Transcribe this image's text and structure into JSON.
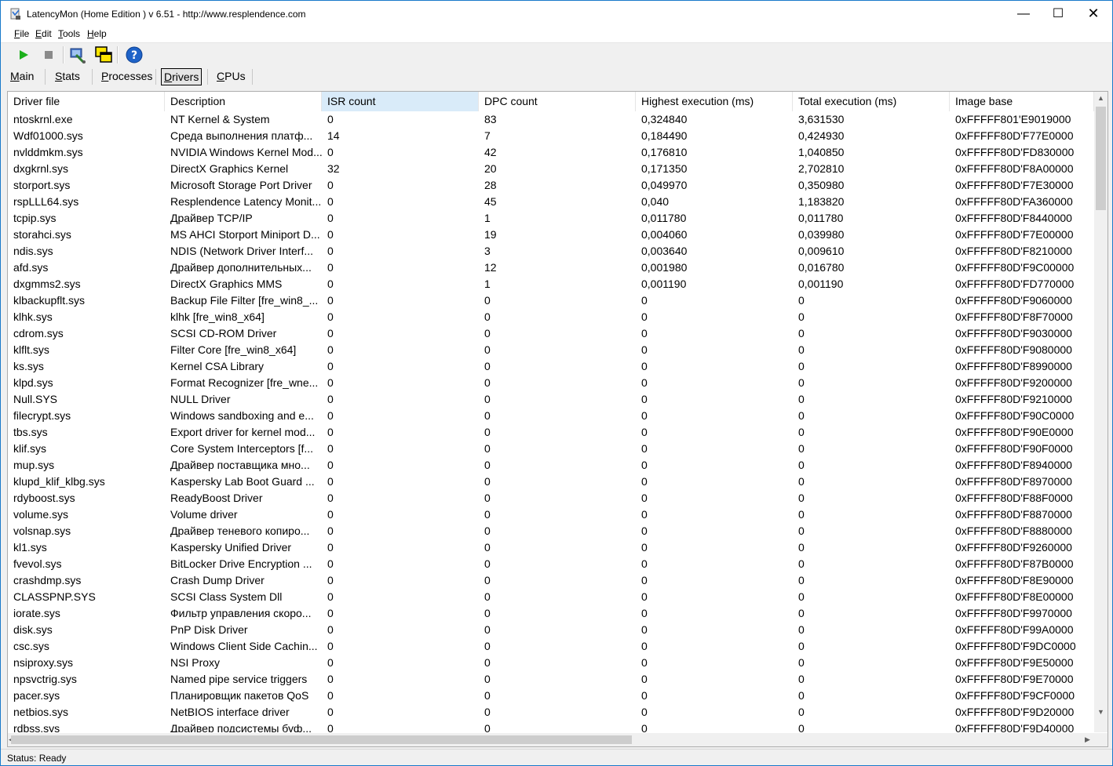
{
  "window": {
    "title": "LatencyMon  (Home Edition )  v 6.51 - http://www.resplendence.com",
    "minimize": "—",
    "maximize": "☐",
    "close": "✕"
  },
  "menu": [
    {
      "label": "File"
    },
    {
      "label": "Edit"
    },
    {
      "label": "Tools"
    },
    {
      "label": "Help"
    }
  ],
  "toolbar": {
    "icons": [
      "play-icon",
      "stop-icon",
      "tools-icon",
      "windows-icon",
      "help-icon"
    ],
    "colors": {
      "play": "#1cb01c",
      "stop": "#8a8a8a",
      "help": "#1e63c8"
    }
  },
  "tabs": [
    {
      "label": "Main"
    },
    {
      "label": "Stats"
    },
    {
      "label": "Processes"
    },
    {
      "label": "Drivers",
      "active": true
    },
    {
      "label": "CPUs"
    }
  ],
  "table": {
    "columns": [
      "Driver file",
      "Description",
      "ISR count",
      "DPC count",
      "Highest execution (ms)",
      "Total execution (ms)",
      "Image base"
    ],
    "sorted_column": "ISR count",
    "rows": [
      [
        "ntoskrnl.exe",
        "NT Kernel & System",
        "0",
        "83",
        "0,324840",
        "3,631530",
        "0xFFFFF801'E9019000"
      ],
      [
        "Wdf01000.sys",
        "Среда выполнения платф...",
        "14",
        "7",
        "0,184490",
        "0,424930",
        "0xFFFFF80D'F77E0000"
      ],
      [
        "nvlddmkm.sys",
        "NVIDIA Windows Kernel Mod...",
        "0",
        "42",
        "0,176810",
        "1,040850",
        "0xFFFFF80D'FD830000"
      ],
      [
        "dxgkrnl.sys",
        "DirectX Graphics Kernel",
        "32",
        "20",
        "0,171350",
        "2,702810",
        "0xFFFFF80D'F8A00000"
      ],
      [
        "storport.sys",
        "Microsoft Storage Port Driver",
        "0",
        "28",
        "0,049970",
        "0,350980",
        "0xFFFFF80D'F7E30000"
      ],
      [
        "rspLLL64.sys",
        "Resplendence Latency Monit...",
        "0",
        "45",
        "0,040",
        "1,183820",
        "0xFFFFF80D'FA360000"
      ],
      [
        "tcpip.sys",
        "Драйвер TCP/IP",
        "0",
        "1",
        "0,011780",
        "0,011780",
        "0xFFFFF80D'F8440000"
      ],
      [
        "storahci.sys",
        "MS AHCI Storport Miniport D...",
        "0",
        "19",
        "0,004060",
        "0,039980",
        "0xFFFFF80D'F7E00000"
      ],
      [
        "ndis.sys",
        "NDIS (Network Driver Interf...",
        "0",
        "3",
        "0,003640",
        "0,009610",
        "0xFFFFF80D'F8210000"
      ],
      [
        "afd.sys",
        "Драйвер дополнительных...",
        "0",
        "12",
        "0,001980",
        "0,016780",
        "0xFFFFF80D'F9C00000"
      ],
      [
        "dxgmms2.sys",
        "DirectX Graphics MMS",
        "0",
        "1",
        "0,001190",
        "0,001190",
        "0xFFFFF80D'FD770000"
      ],
      [
        "klbackupflt.sys",
        "Backup File Filter [fre_win8_...",
        "0",
        "0",
        "0",
        "0",
        "0xFFFFF80D'F9060000"
      ],
      [
        "klhk.sys",
        "klhk [fre_win8_x64]",
        "0",
        "0",
        "0",
        "0",
        "0xFFFFF80D'F8F70000"
      ],
      [
        "cdrom.sys",
        "SCSI CD-ROM Driver",
        "0",
        "0",
        "0",
        "0",
        "0xFFFFF80D'F9030000"
      ],
      [
        "klflt.sys",
        "Filter Core [fre_win8_x64]",
        "0",
        "0",
        "0",
        "0",
        "0xFFFFF80D'F9080000"
      ],
      [
        "ks.sys",
        "Kernel CSA Library",
        "0",
        "0",
        "0",
        "0",
        "0xFFFFF80D'F8990000"
      ],
      [
        "klpd.sys",
        "Format Recognizer [fre_wne...",
        "0",
        "0",
        "0",
        "0",
        "0xFFFFF80D'F9200000"
      ],
      [
        "Null.SYS",
        "NULL Driver",
        "0",
        "0",
        "0",
        "0",
        "0xFFFFF80D'F9210000"
      ],
      [
        "filecrypt.sys",
        "Windows sandboxing and e...",
        "0",
        "0",
        "0",
        "0",
        "0xFFFFF80D'F90C0000"
      ],
      [
        "tbs.sys",
        "Export driver for kernel mod...",
        "0",
        "0",
        "0",
        "0",
        "0xFFFFF80D'F90E0000"
      ],
      [
        "klif.sys",
        "Core System Interceptors [f...",
        "0",
        "0",
        "0",
        "0",
        "0xFFFFF80D'F90F0000"
      ],
      [
        "mup.sys",
        "Драйвер поставщика мно...",
        "0",
        "0",
        "0",
        "0",
        "0xFFFFF80D'F8940000"
      ],
      [
        "klupd_klif_klbg.sys",
        "Kaspersky Lab Boot Guard ...",
        "0",
        "0",
        "0",
        "0",
        "0xFFFFF80D'F8970000"
      ],
      [
        "rdyboost.sys",
        "ReadyBoost Driver",
        "0",
        "0",
        "0",
        "0",
        "0xFFFFF80D'F88F0000"
      ],
      [
        "volume.sys",
        "Volume driver",
        "0",
        "0",
        "0",
        "0",
        "0xFFFFF80D'F8870000"
      ],
      [
        "volsnap.sys",
        "Драйвер теневого копиро...",
        "0",
        "0",
        "0",
        "0",
        "0xFFFFF80D'F8880000"
      ],
      [
        "kl1.sys",
        "Kaspersky Unified Driver",
        "0",
        "0",
        "0",
        "0",
        "0xFFFFF80D'F9260000"
      ],
      [
        "fvevol.sys",
        "BitLocker Drive Encryption ...",
        "0",
        "0",
        "0",
        "0",
        "0xFFFFF80D'F87B0000"
      ],
      [
        "crashdmp.sys",
        "Crash Dump Driver",
        "0",
        "0",
        "0",
        "0",
        "0xFFFFF80D'F8E90000"
      ],
      [
        "CLASSPNP.SYS",
        "SCSI Class System Dll",
        "0",
        "0",
        "0",
        "0",
        "0xFFFFF80D'F8E00000"
      ],
      [
        "iorate.sys",
        "Фильтр управления скоро...",
        "0",
        "0",
        "0",
        "0",
        "0xFFFFF80D'F9970000"
      ],
      [
        "disk.sys",
        "PnP Disk Driver",
        "0",
        "0",
        "0",
        "0",
        "0xFFFFF80D'F99A0000"
      ],
      [
        "csc.sys",
        "Windows Client Side Cachin...",
        "0",
        "0",
        "0",
        "0",
        "0xFFFFF80D'F9DC0000"
      ],
      [
        "nsiproxy.sys",
        "NSI Proxy",
        "0",
        "0",
        "0",
        "0",
        "0xFFFFF80D'F9E50000"
      ],
      [
        "npsvctrig.sys",
        "Named pipe service triggers",
        "0",
        "0",
        "0",
        "0",
        "0xFFFFF80D'F9E70000"
      ],
      [
        "pacer.sys",
        "Планировщик пакетов QoS",
        "0",
        "0",
        "0",
        "0",
        "0xFFFFF80D'F9CF0000"
      ],
      [
        "netbios.sys",
        "NetBIOS interface driver",
        "0",
        "0",
        "0",
        "0",
        "0xFFFFF80D'F9D20000"
      ],
      [
        "rdbss.sys",
        "Драйвер подсистемы буф...",
        "0",
        "0",
        "0",
        "0",
        "0xFFFFF80D'F9D40000"
      ]
    ]
  },
  "status": {
    "text": "Status: Ready"
  }
}
